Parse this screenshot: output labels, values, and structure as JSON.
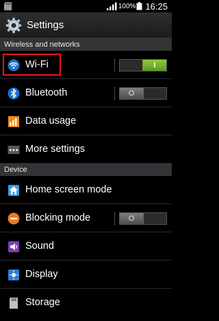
{
  "status_bar": {
    "battery_percent": "100%",
    "time": "16:25"
  },
  "action_bar": {
    "title": "Settings",
    "icon": "settings-gear-icon"
  },
  "sections": {
    "wireless": "Wireless and networks",
    "device": "Device"
  },
  "items": {
    "wifi": {
      "label": "Wi-Fi",
      "icon": "wifi-icon",
      "toggle_state": "on",
      "toggle_text": "I"
    },
    "bluetooth": {
      "label": "Bluetooth",
      "icon": "bluetooth-icon",
      "toggle_state": "off",
      "toggle_text": "O"
    },
    "data_usage": {
      "label": "Data usage",
      "icon": "data-usage-icon"
    },
    "more_settings": {
      "label": "More settings",
      "icon": "more-icon"
    },
    "home_screen": {
      "label": "Home screen mode",
      "icon": "home-icon"
    },
    "blocking": {
      "label": "Blocking mode",
      "icon": "blocking-icon",
      "toggle_state": "off",
      "toggle_text": "O"
    },
    "sound": {
      "label": "Sound",
      "icon": "speaker-icon"
    },
    "display": {
      "label": "Display",
      "icon": "display-icon"
    },
    "storage": {
      "label": "Storage",
      "icon": "storage-icon"
    }
  },
  "colors": {
    "highlight": "#e8191e",
    "toggle_on": "#7ab832",
    "section_bg": "#333437"
  }
}
